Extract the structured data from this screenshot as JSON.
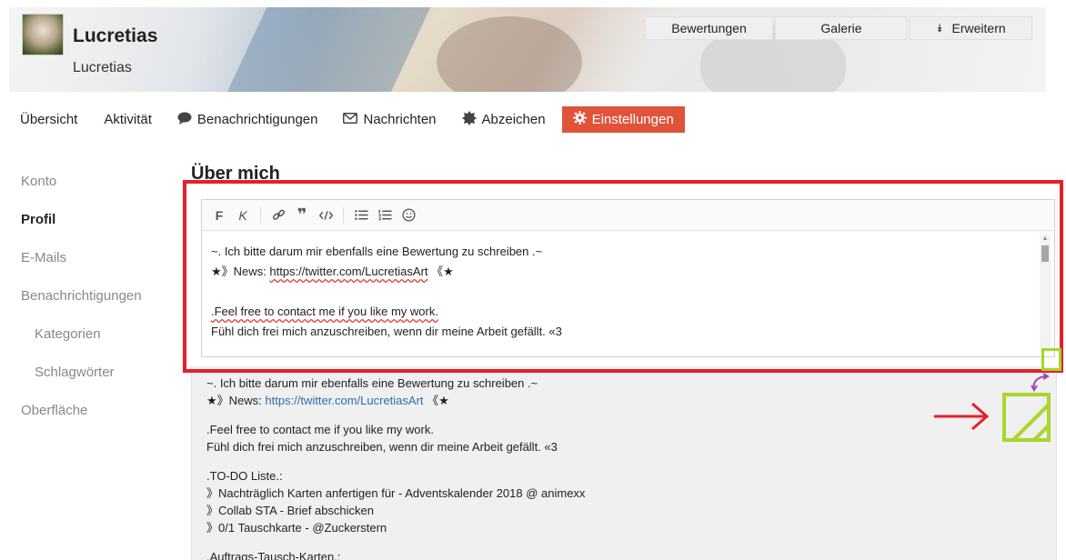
{
  "header": {
    "user_name": "Lucretias",
    "user_sub": "Lucretias",
    "buttons": [
      "Bewertungen",
      "Galerie",
      "Erweitern"
    ]
  },
  "tabs": [
    {
      "label": "Übersicht",
      "icon": ""
    },
    {
      "label": "Aktivität",
      "icon": ""
    },
    {
      "label": "Benachrichtigungen",
      "icon": "comment-icon"
    },
    {
      "label": "Nachrichten",
      "icon": "envelope-icon"
    },
    {
      "label": "Abzeichen",
      "icon": "badge-icon"
    },
    {
      "label": "Einstellungen",
      "icon": "gear-icon"
    }
  ],
  "active_tab": "Einstellungen",
  "sidebar": {
    "items": [
      {
        "label": "Konto"
      },
      {
        "label": "Profil"
      },
      {
        "label": "E-Mails"
      },
      {
        "label": "Benachrichtigungen"
      },
      {
        "label": "Kategorien"
      },
      {
        "label": "Schlagwörter"
      },
      {
        "label": "Oberfläche"
      }
    ],
    "active": "Profil"
  },
  "section_title": "Über mich",
  "toolbar": {
    "bold": "F",
    "italic": "K",
    "icons": [
      "bold-icon",
      "italic-icon",
      "link-icon",
      "quote-icon",
      "code-icon",
      "bullet-list-icon",
      "numbered-list-icon",
      "emoji-icon"
    ]
  },
  "editor": {
    "line1": "~. Ich bitte darum mir ebenfalls eine Bewertung zu schreiben .~",
    "line2_prefix": "★》News: ",
    "line2_link": "https://twitter.com/LucretiasArt",
    "line2_suffix": " 《★",
    "line3": ".Feel free to contact me if you like my work.",
    "line4": "Fühl dich frei mich anzuschreiben, wenn dir meine Arbeit gefällt. «3"
  },
  "preview": {
    "line1": "~. Ich bitte darum mir ebenfalls eine Bewertung zu schreiben .~",
    "line2_prefix": "★》News: ",
    "line2_link": "https://twitter.com/LucretiasArt",
    "line2_suffix": " 《★",
    "line3": ".Feel free to contact me if you like my work.",
    "line4": "Fühl dich frei mich anzuschreiben, wenn dir meine Arbeit gefällt. «3",
    "line5": ".TO-DO Liste.:",
    "line6": "》Nachträglich Karten anfertigen für - Adventskalender 2018 @ animexx",
    "line7": "》Collab STA - Brief abschicken",
    "line8": "》0/1 Tauschkarte - @Zuckerstern",
    "line9": ".Auftrags-Tausch-Karten.:"
  },
  "colors": {
    "accent": "#e0533b",
    "highlight_red": "#e5202a",
    "highlight_green": "#a8d62a",
    "arrow_purple": "#9b45b8",
    "link": "#2a6fb0"
  }
}
